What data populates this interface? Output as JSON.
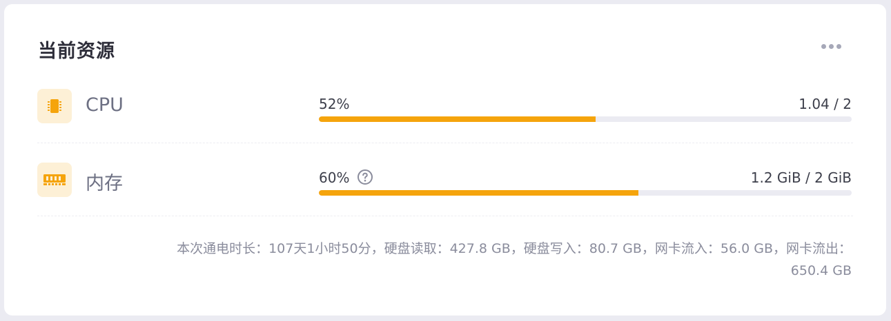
{
  "card": {
    "title": "当前资源"
  },
  "resources": [
    {
      "label": "CPU",
      "percent_text": "52%",
      "value_text": "1.04 / 2",
      "fraction": 0.52,
      "icon": "cpu-chip-icon",
      "has_help": false
    },
    {
      "label": "内存",
      "percent_text": "60%",
      "value_text": "1.2 GiB / 2 GiB",
      "fraction": 0.6,
      "icon": "memory-module-icon",
      "has_help": true
    }
  ],
  "footer": {
    "line1": "本次通电时长：107天1小时50分，硬盘读取：427.8 GB，硬盘写入：80.7 GB，网卡流入：56.0 GB，网卡流出：",
    "line2": "650.4 GB"
  },
  "colors": {
    "accent": "#f5a40c",
    "icon_bg": "#fdf0d6",
    "track": "#ebebf2"
  }
}
